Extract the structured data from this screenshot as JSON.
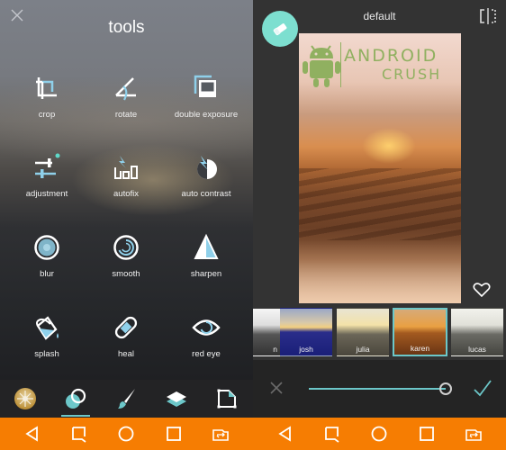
{
  "left_screen": {
    "close_label": "×",
    "title": "tools",
    "tools": [
      {
        "label": "crop",
        "icon": "crop-icon"
      },
      {
        "label": "rotate",
        "icon": "rotate-icon"
      },
      {
        "label": "double exposure",
        "icon": "double-exposure-icon"
      },
      {
        "label": "adjustment",
        "icon": "adjustment-icon"
      },
      {
        "label": "autofix",
        "icon": "autofix-icon"
      },
      {
        "label": "auto contrast",
        "icon": "auto-contrast-icon"
      },
      {
        "label": "blur",
        "icon": "blur-icon"
      },
      {
        "label": "smooth",
        "icon": "smooth-icon"
      },
      {
        "label": "sharpen",
        "icon": "sharpen-icon"
      },
      {
        "label": "splash",
        "icon": "splash-icon"
      },
      {
        "label": "heal",
        "icon": "heal-icon"
      },
      {
        "label": "red eye",
        "icon": "red-eye-icon"
      }
    ],
    "toolbar": [
      {
        "icon": "effects-icon",
        "active": false
      },
      {
        "icon": "tools-icon",
        "active": true
      },
      {
        "icon": "brush-icon",
        "active": false
      },
      {
        "icon": "layers-icon",
        "active": false
      },
      {
        "icon": "sticker-icon",
        "active": false
      }
    ]
  },
  "right_screen": {
    "title": "default",
    "watermark": {
      "line1": "ANDROID",
      "line2": "CRUSH"
    },
    "filters": [
      {
        "name": "n",
        "selected": false
      },
      {
        "name": "josh",
        "selected": false
      },
      {
        "name": "julia",
        "selected": false
      },
      {
        "name": "karen",
        "selected": true
      },
      {
        "name": "lucas",
        "selected": false
      }
    ],
    "slider": {
      "value": 1.0
    }
  },
  "navbar": {
    "buttons": [
      "back",
      "recent-search",
      "home",
      "overview",
      "switch-apps"
    ]
  },
  "colors": {
    "accent": "#6cc7c9",
    "fab": "#7ddfd0",
    "navbar": "#f67d02",
    "panel": "#333333"
  }
}
